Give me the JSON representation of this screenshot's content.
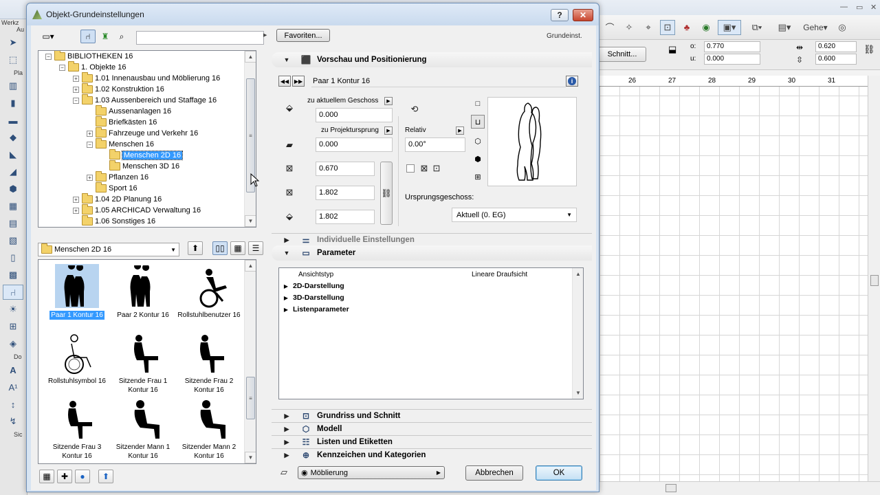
{
  "background_app": {
    "toolbar_right_label": "Gehe",
    "schnitt_button": "Schnitt...",
    "coord_o_label": "o:",
    "coord_o_value": "0.770",
    "coord_u_label": "u:",
    "coord_u_value": "0.000",
    "size_a_value": "0.620",
    "size_b_value": "0.600",
    "ruler_ticks": [
      "26",
      "27",
      "28",
      "29",
      "30",
      "31"
    ],
    "left_strip_labels": [
      "Werkz",
      "Au",
      "Pla",
      "Do",
      "Sic"
    ]
  },
  "dialog": {
    "title": "Objekt-Grundeinstellungen",
    "help_label": "?",
    "close_label": "✕"
  },
  "library": {
    "search_value": "",
    "tree": [
      {
        "label": "BIBLIOTHEKEN 16",
        "level": 0,
        "exp": "−"
      },
      {
        "label": "1. Objekte 16",
        "level": 1,
        "exp": "−"
      },
      {
        "label": "1.01 Innenausbau und Möblierung 16",
        "level": 2,
        "exp": "+"
      },
      {
        "label": "1.02 Konstruktion 16",
        "level": 2,
        "exp": "+"
      },
      {
        "label": "1.03 Aussenbereich und Staffage 16",
        "level": 2,
        "exp": "−"
      },
      {
        "label": "Aussenanlagen 16",
        "level": 3,
        "exp": ""
      },
      {
        "label": "Briefkästen 16",
        "level": 3,
        "exp": ""
      },
      {
        "label": "Fahrzeuge und Verkehr 16",
        "level": 3,
        "exp": "+"
      },
      {
        "label": "Menschen 16",
        "level": 3,
        "exp": "−"
      },
      {
        "label": "Menschen 2D 16",
        "level": 4,
        "exp": "",
        "selected": true
      },
      {
        "label": "Menschen 3D 16",
        "level": 4,
        "exp": ""
      },
      {
        "label": "Pflanzen 16",
        "level": 3,
        "exp": "+"
      },
      {
        "label": "Sport 16",
        "level": 3,
        "exp": ""
      },
      {
        "label": "1.04 2D Planung 16",
        "level": 2,
        "exp": "+"
      },
      {
        "label": "1.05 ARCHICAD Verwaltung 16",
        "level": 2,
        "exp": "+"
      },
      {
        "label": "1.06 Sonstiges 16",
        "level": 2,
        "exp": ""
      }
    ],
    "current_folder": "Menschen 2D 16",
    "objects": [
      {
        "label": "Paar 1 Kontur 16",
        "icon": "couple-figure-icon",
        "selected": true
      },
      {
        "label": "Paar 2 Kontur 16",
        "icon": "couple-figure-icon"
      },
      {
        "label": "Rollstuhlbenutzer 16",
        "icon": "wheelchair-user-icon"
      },
      {
        "label": "Rollstuhlsymbol 16",
        "icon": "wheelchair-symbol-icon"
      },
      {
        "label": "Sitzende Frau 1 Kontur 16",
        "icon": "sitting-woman-icon"
      },
      {
        "label": "Sitzende Frau 2 Kontur 16",
        "icon": "sitting-woman-icon"
      },
      {
        "label": "Sitzende Frau 3 Kontur 16",
        "icon": "sitting-woman-icon"
      },
      {
        "label": "Sitzender Mann 1 Kontur 16",
        "icon": "sitting-man-icon"
      },
      {
        "label": "Sitzender Mann 2 Kontur 16",
        "icon": "sitting-man-icon"
      }
    ]
  },
  "settings": {
    "favorites_label": "Favoriten...",
    "defaults_label": "Grundeinst.",
    "section_preview": "Vorschau und Positionierung",
    "object_name": "Paar 1 Kontur 16",
    "rel_story_label": "zu aktuellem Geschoss",
    "rel_story_value": "0.000",
    "rel_origin_label": "zu Projektursprung",
    "rel_origin_value": "0.000",
    "width_value": "0.670",
    "depth_value": "1.802",
    "height_value": "1.802",
    "relativ_label": "Relativ",
    "rotation_value": "0.00°",
    "home_story_label": "Ursprungsgeschoss:",
    "home_story_value": "Aktuell (0. EG)",
    "section_custom": "Individuelle Einstellungen",
    "section_params": "Parameter",
    "param_header_left": "Ansichtstyp",
    "param_header_right": "Lineare Draufsicht",
    "param_rows": [
      "2D-Darstellung",
      "3D-Darstellung",
      "Listenparameter"
    ],
    "section_floorplan": "Grundriss und Schnitt",
    "section_model": "Modell",
    "section_lists": "Listen und Etiketten",
    "section_tags": "Kennzeichen und Kategorien",
    "layer_value": "Möblierung",
    "cancel_label": "Abbrechen",
    "ok_label": "OK"
  }
}
